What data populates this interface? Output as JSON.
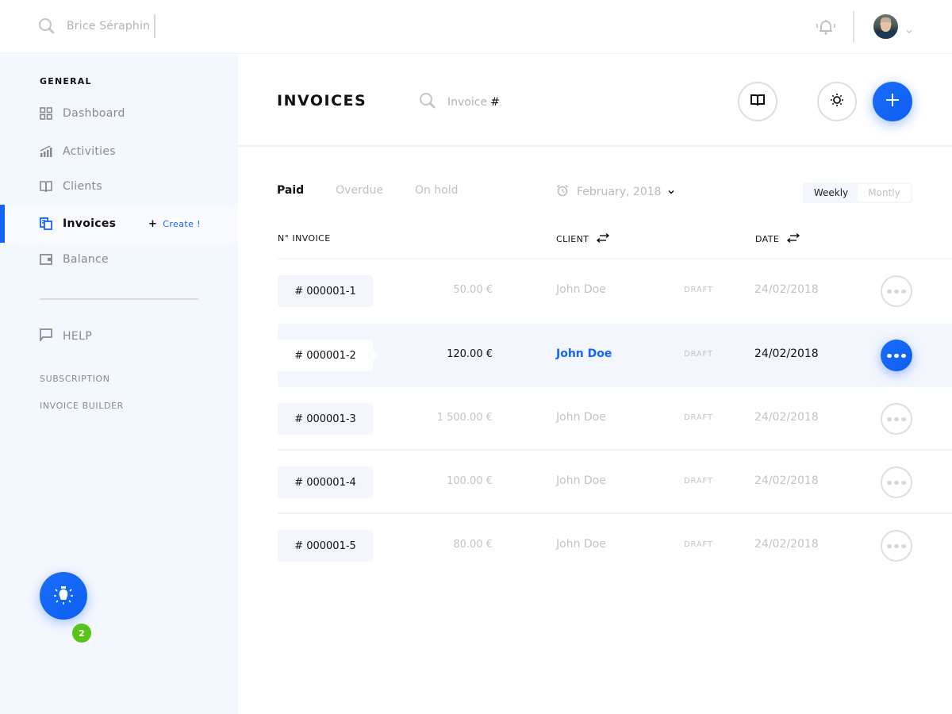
{
  "topbar": {
    "search_value": "Brice Séraphin",
    "icons": {
      "search": "search-icon",
      "notifications": "bell-icon",
      "avatar_menu": "chevron-down-icon"
    }
  },
  "sidebar": {
    "section_title": "GENERAL",
    "items": [
      {
        "label": "Dashboard",
        "icon": "grid-icon"
      },
      {
        "label": "Activities",
        "icon": "bar-chart-icon"
      },
      {
        "label": "Clients",
        "icon": "book-icon"
      },
      {
        "label": "Invoices",
        "icon": "invoice-icon",
        "active": true
      },
      {
        "label": "Balance",
        "icon": "wallet-icon"
      }
    ],
    "create_label": "Create !",
    "help_label": "HELP",
    "links": [
      "SUBSCRIPTION",
      "INVOICE BUILDER"
    ],
    "notification_count": "2"
  },
  "header": {
    "title": "INVOICES",
    "search_placeholder": "Invoice",
    "search_hash": "#"
  },
  "filters": {
    "tabs": [
      "Paid",
      "Overdue",
      "On hold"
    ],
    "active_tab": "Paid",
    "month": "February, 2018",
    "period_options": [
      "Weekly",
      "Montly"
    ],
    "active_period": "Weekly"
  },
  "table": {
    "columns": {
      "invoice": "N° INVOICE",
      "client": "CLIENT",
      "date": "DATE"
    },
    "rows": [
      {
        "number": "# 000001-1",
        "amount": "50.00 €",
        "client": "John Doe",
        "status": "DRAFT",
        "date": "24/02/2018"
      },
      {
        "number": "# 000001-2",
        "amount": "120.00 €",
        "client": "John Doe",
        "status": "DRAFT",
        "date": "24/02/2018",
        "highlighted": true
      },
      {
        "number": "# 000001-3",
        "amount": "1 500.00 €",
        "client": "John Doe",
        "status": "DRAFT",
        "date": "24/02/2018"
      },
      {
        "number": "# 000001-4",
        "amount": "100.00 €",
        "client": "John Doe",
        "status": "DRAFT",
        "date": "24/02/2018"
      },
      {
        "number": "# 000001-5",
        "amount": "80.00 €",
        "client": "John Doe",
        "status": "DRAFT",
        "date": "24/02/2018"
      }
    ]
  },
  "colors": {
    "accent": "#1464f6",
    "badge": "#5ac31a",
    "sidebar_bg": "#f3f7fe",
    "muted_text": "#c3c3c3"
  }
}
